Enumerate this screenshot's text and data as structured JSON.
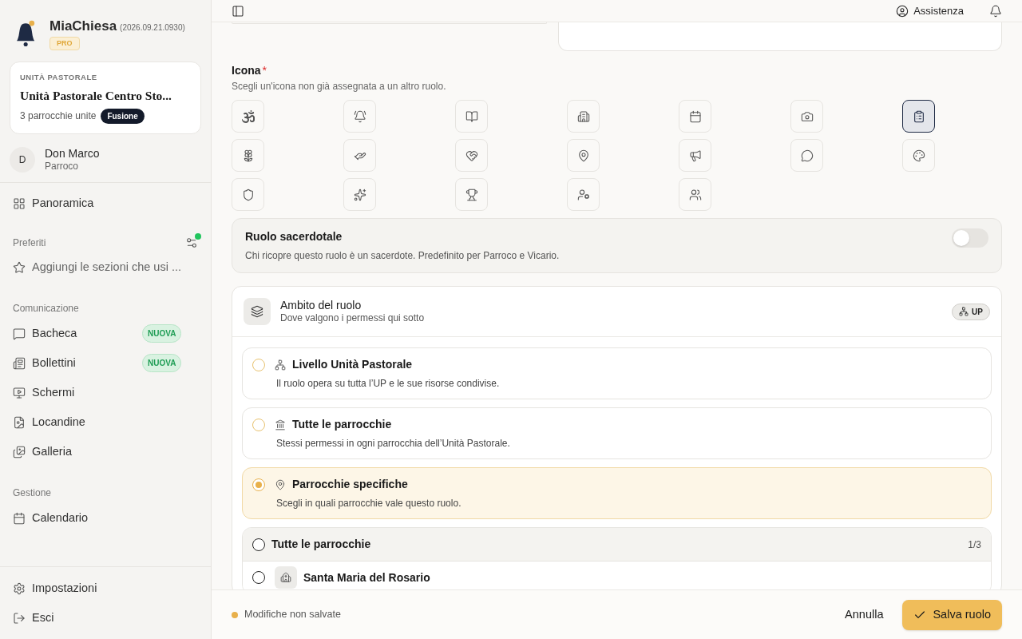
{
  "sidebar": {
    "app_name": "MiaChiesa",
    "version": "(2026.09.21.0930)",
    "plan_badge": "PRO",
    "unit_card": {
      "eyebrow": "UNITÀ PASTORALE",
      "name": "Unità Pastorale Centro Sto...",
      "subtitle": "3 parrocchie unite",
      "badge": "Fusione"
    },
    "user": {
      "initial": "D",
      "name": "Don Marco",
      "role": "Parroco"
    },
    "overview": {
      "label": "Panoramica"
    },
    "favorites": {
      "title": "Preferiti",
      "has_update": true,
      "hint": "Aggiungi le sezioni che usi ..."
    },
    "sections": [
      {
        "title": "Comunicazione",
        "items": [
          {
            "label": "Bacheca",
            "badge": "NUOVA"
          },
          {
            "label": "Bollettini",
            "badge": "NUOVA"
          },
          {
            "label": "Schermi"
          },
          {
            "label": "Locandine"
          },
          {
            "label": "Galleria"
          }
        ]
      },
      {
        "title": "Gestione",
        "items": [
          {
            "label": "Calendario"
          }
        ]
      }
    ],
    "footer_items": [
      {
        "label": "Impostazioni"
      },
      {
        "label": "Esci"
      }
    ]
  },
  "header": {
    "help": "Assistenza"
  },
  "icon_field": {
    "label": "Icona",
    "required_mark": "*",
    "hint": "Scegli un'icona non già assegnata a un altro ruolo.",
    "options": [
      {
        "selected": false
      },
      {
        "selected": false
      },
      {
        "selected": false
      },
      {
        "selected": false
      },
      {
        "selected": false
      },
      {
        "selected": false
      },
      {
        "selected": true
      },
      {
        "selected": false
      },
      {
        "selected": false
      },
      {
        "selected": false
      },
      {
        "selected": false
      },
      {
        "selected": false
      },
      {
        "selected": false
      },
      {
        "selected": false
      },
      {
        "selected": false
      },
      {
        "selected": false
      },
      {
        "selected": false
      },
      {
        "selected": false
      },
      {
        "selected": false
      }
    ]
  },
  "priest_role": {
    "title": "Ruolo sacerdotale",
    "description": "Chi ricopre questo ruolo è un sacerdote. Predefinito per Parroco e Vicario.",
    "on": false
  },
  "scope": {
    "title": "Ambito del ruolo",
    "subtitle": "Dove valgono i permessi qui sotto",
    "badge": "UP",
    "options": [
      {
        "title": "Livello Unità Pastorale",
        "description": "Il ruolo opera su tutta l’UP e le sue risorse condivise.",
        "selected": false
      },
      {
        "title": "Tutte le parrocchie",
        "description": "Stessi permessi in ogni parrocchia dell’Unità Pastorale.",
        "selected": false
      },
      {
        "title": "Parrocchie specifiche",
        "description": "Scegli in quali parrocchie vale questo ruolo.",
        "selected": true
      }
    ],
    "parishes": {
      "all_label": "Tutte le parrocchie",
      "all_checked": false,
      "count": "1/3",
      "items": [
        {
          "name": "Santa Maria del Rosario",
          "checked": false
        }
      ]
    }
  },
  "footer": {
    "status": "Modifiche non salvate",
    "cancel": "Annulla",
    "save": "Salva ruolo"
  }
}
